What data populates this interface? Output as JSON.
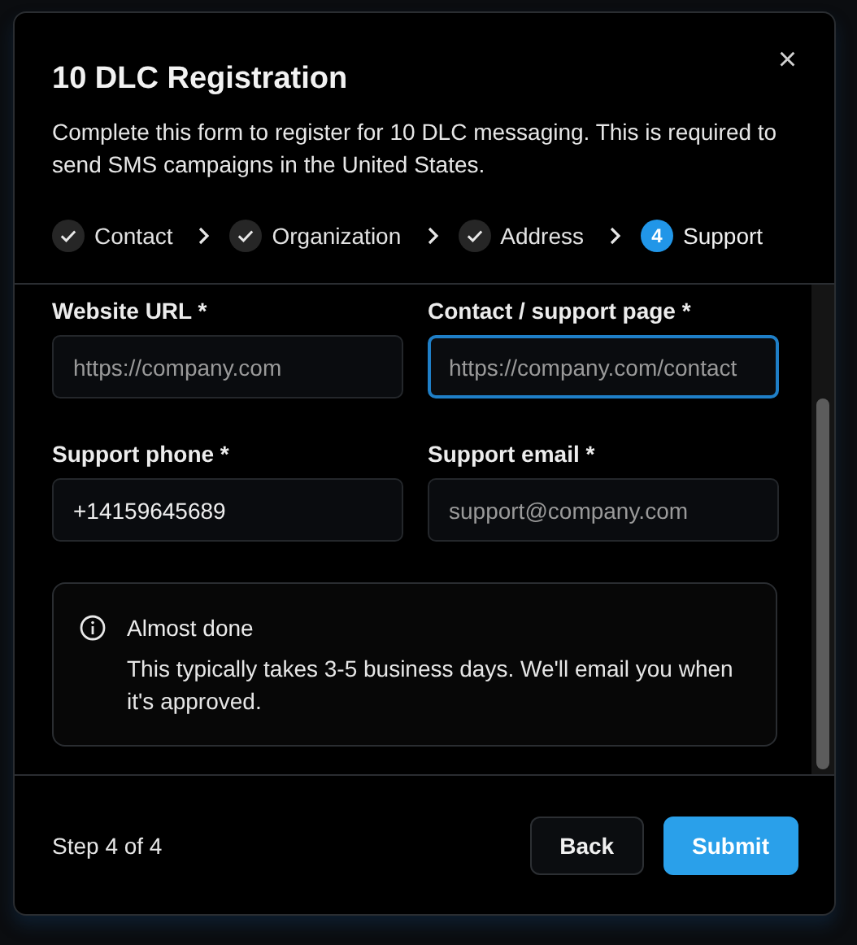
{
  "dialog": {
    "title": "10 DLC Registration",
    "description": "Complete this form to register for 10 DLC messaging. This is required to send SMS campaigns in the United States.",
    "close": "×"
  },
  "steps": [
    {
      "label": "Contact",
      "completed": true,
      "selected": false
    },
    {
      "label": "Organization",
      "completed": true,
      "selected": false
    },
    {
      "label": "Address",
      "completed": true,
      "selected": false
    },
    {
      "number": "4",
      "label": "Support",
      "completed": false,
      "selected": true
    }
  ],
  "fields": [
    {
      "label": "Website URL *",
      "placeholder": "https://company.com",
      "focused": false
    },
    {
      "label": "Contact / support page *",
      "placeholder": "https://company.com/contact",
      "focused": true
    },
    {
      "label": "Support phone *",
      "value": "+14159645689",
      "focused": false
    },
    {
      "label": "Support email *",
      "placeholder": "support@company.com",
      "focused": false
    }
  ],
  "notice": {
    "title": "Almost done",
    "text": "This typically takes 3-5 business days. We'll email you when it's approved."
  },
  "footer": {
    "step_text": "Step 4 of 4",
    "buttons": [
      {
        "label": "Back",
        "kind": "secondary"
      },
      {
        "label": "Submit",
        "kind": "primary"
      }
    ]
  }
}
